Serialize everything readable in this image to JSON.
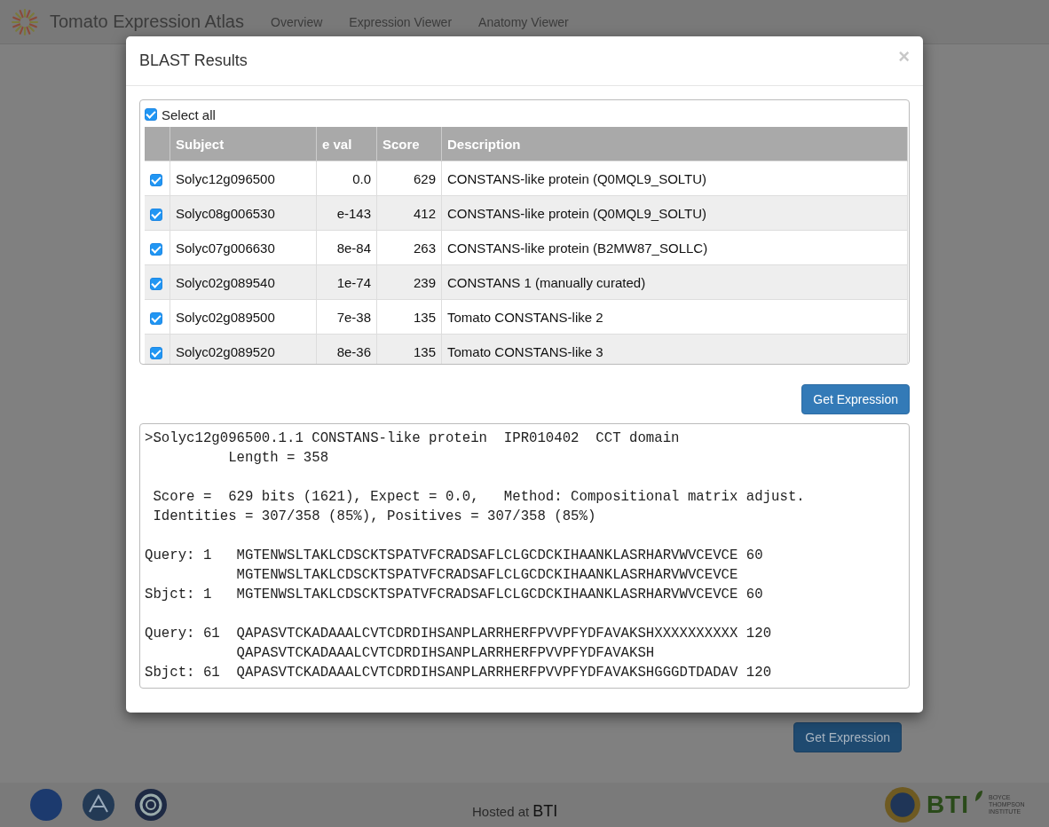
{
  "navbar": {
    "brand": "Tomato Expression Atlas",
    "links": [
      "Overview",
      "Expression Viewer",
      "Anatomy Viewer"
    ]
  },
  "modal": {
    "title": "BLAST Results",
    "close": "×",
    "select_all": {
      "label": "Select all",
      "checked": true
    },
    "table": {
      "columns": [
        "Subject",
        "e val",
        "Score",
        "Description"
      ],
      "rows": [
        {
          "checked": true,
          "cells": [
            "Solyc12g096500",
            "0.0",
            "629",
            "CONSTANS-like protein (Q0MQL9_SOLTU)"
          ]
        },
        {
          "checked": true,
          "cells": [
            "Solyc08g006530",
            "e-143",
            "412",
            "CONSTANS-like protein (Q0MQL9_SOLTU)"
          ]
        },
        {
          "checked": true,
          "cells": [
            "Solyc07g006630",
            "8e-84",
            "263",
            "CONSTANS-like protein (B2MW87_SOLLC)"
          ]
        },
        {
          "checked": true,
          "cells": [
            "Solyc02g089540",
            "1e-74",
            "239",
            "CONSTANS 1 (manually curated)"
          ]
        },
        {
          "checked": true,
          "cells": [
            "Solyc02g089500",
            "7e-38",
            "135",
            "Tomato CONSTANS-like 2"
          ]
        },
        {
          "checked": true,
          "cells": [
            "Solyc02g089520",
            "8e-36",
            "135",
            "Tomato CONSTANS-like 3"
          ]
        }
      ]
    },
    "button": "Get Expression",
    "alignment": [
      [
        ">Solyc12g096500.1.1 CONSTANS-like protein  IPR010402  CCT domain",
        "          Length = 358"
      ],
      [
        " Score =  629 bits (1621), Expect = 0.0,   Method: Compositional matrix adjust.",
        " Identities = 307/358 (85%), Positives = 307/358 (85%)"
      ],
      [
        "Query: 1   MGTENWSLTAKLCDSCKTSPATVFCRADSAFLCLGCDCKIHAANKLASRHARVWVCEVCE 60",
        "           MGTENWSLTAKLCDSCKTSPATVFCRADSAFLCLGCDCKIHAANKLASRHARVWVCEVCE",
        "Sbjct: 1   MGTENWSLTAKLCDSCKTSPATVFCRADSAFLCLGCDCKIHAANKLASRHARVWVCEVCE 60"
      ],
      [
        "Query: 61  QAPASVTCKADAAALCVTCDRDIHSANPLARRHERFPVVPFYDFAVAKSHXXXXXXXXXX 120",
        "           QAPASVTCKADAAALCVTCDRDIHSANPLARRHERFPVVPFYDFAVAKSH",
        "Sbjct: 61  QAPASVTCKADAAALCVTCDRDIHSANPLARRHERFPVVPFYDFAVAKSHGGGDTDADAV 120"
      ]
    ]
  },
  "page_button": "Get Expression",
  "footer": {
    "hosted_prefix": "Hosted at",
    "hosted_name": "BTI",
    "bti_logo": "BTI",
    "bti_logo_sub": "BOYCE THOMPSON INSTITUTE"
  }
}
